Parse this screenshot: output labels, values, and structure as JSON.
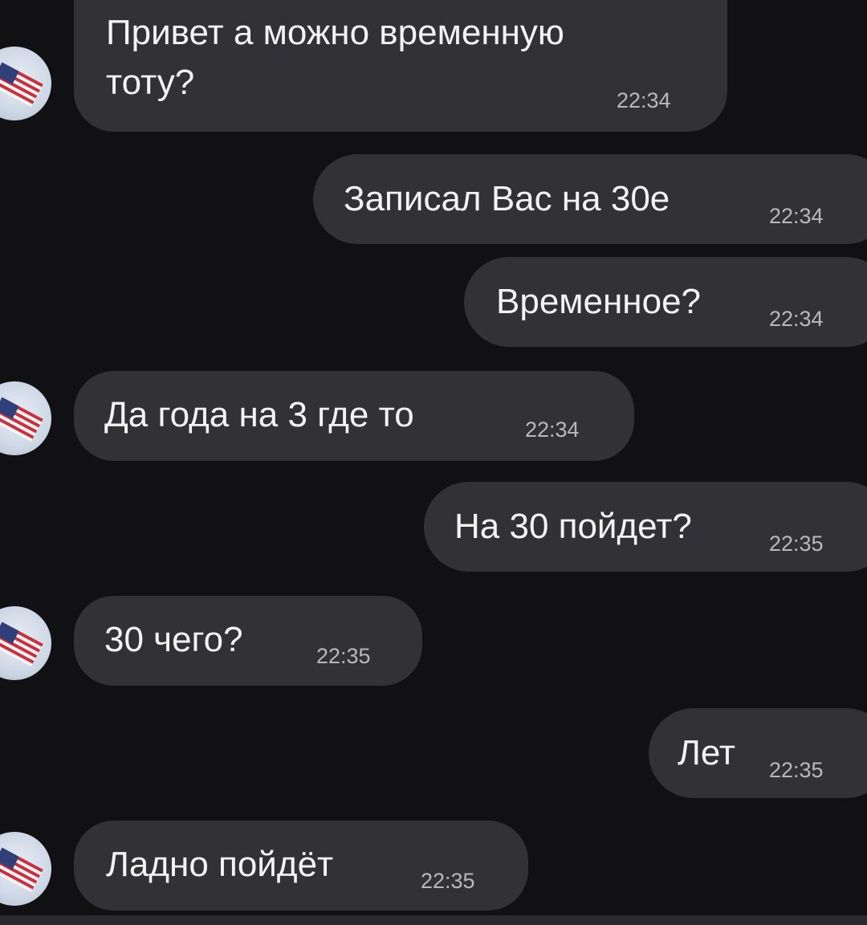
{
  "messages": [
    {
      "id": "m1",
      "direction": "in",
      "text_line1": "Привет а можно временную",
      "text_line2": "тоту?",
      "time": "22:34"
    },
    {
      "id": "m2",
      "direction": "out",
      "text": "Записал Вас на 30е",
      "time": "22:34"
    },
    {
      "id": "m3",
      "direction": "out",
      "text": "Временное?",
      "time": "22:34"
    },
    {
      "id": "m4",
      "direction": "in",
      "text": "Да года на 3 где то",
      "time": "22:34"
    },
    {
      "id": "m5",
      "direction": "out",
      "text": "На 30 пойдет?",
      "time": "22:35"
    },
    {
      "id": "m6",
      "direction": "in",
      "text": "30 чего?",
      "time": "22:35"
    },
    {
      "id": "m7",
      "direction": "out",
      "text": "Лет",
      "time": "22:35"
    },
    {
      "id": "m8",
      "direction": "in",
      "text": "Ладно пойдёт",
      "time": "22:35"
    }
  ],
  "avatar": {
    "icon": "flag-avatar-icon"
  },
  "colors": {
    "background": "#111113",
    "bubble": "#323236",
    "text": "#f3f3f3",
    "time": "#b9b9bd"
  }
}
